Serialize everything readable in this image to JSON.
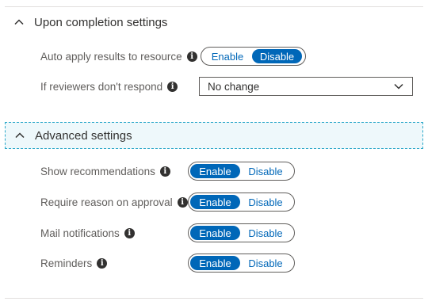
{
  "completion": {
    "title": "Upon completion settings",
    "auto_apply": {
      "label": "Auto apply results to resource",
      "enable": "Enable",
      "disable": "Disable",
      "selected": "Disable"
    },
    "no_response": {
      "label": "If reviewers don't respond",
      "value": "No change"
    }
  },
  "advanced": {
    "title": "Advanced settings",
    "settings": [
      {
        "label": "Show recommendations",
        "enable": "Enable",
        "disable": "Disable",
        "selected": "Enable"
      },
      {
        "label": "Require reason on approval",
        "enable": "Enable",
        "disable": "Disable",
        "selected": "Enable"
      },
      {
        "label": "Mail notifications",
        "enable": "Enable",
        "disable": "Disable",
        "selected": "Enable"
      },
      {
        "label": "Reminders",
        "enable": "Enable",
        "disable": "Disable",
        "selected": "Enable"
      }
    ]
  },
  "icons": {
    "chevron": "chevron-up-icon",
    "info": "info-icon",
    "dropdown": "chevron-down-icon"
  },
  "colors": {
    "accent": "#0067b8",
    "focus_border": "#2aa7c9"
  }
}
